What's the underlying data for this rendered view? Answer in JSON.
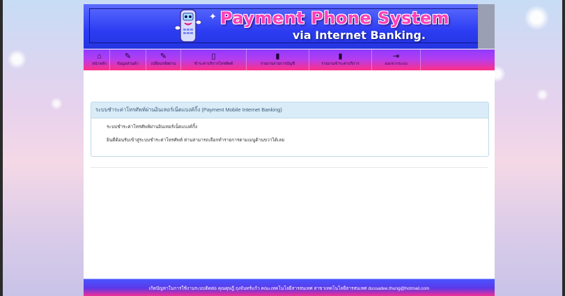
{
  "banner": {
    "title": "Payment Phone System",
    "subtitle": "via Internet Banking."
  },
  "nav": {
    "items": [
      {
        "label": "หน้าหลัก",
        "icon": "home-icon",
        "glyph": "⌂"
      },
      {
        "label": "ข้อมูลส่วนตัว",
        "icon": "edit-icon",
        "glyph": "✎"
      },
      {
        "label": "เปลี่ยนรหัสผ่าน",
        "icon": "edit-icon",
        "glyph": "✎"
      },
      {
        "label": "ชำระค่าบริการโทรศัพท์",
        "icon": "mobile-icon",
        "glyph": "▯"
      },
      {
        "label": "รายงานรายการบัญชี",
        "icon": "file-icon",
        "glyph": "▮"
      },
      {
        "label": "รายงานชำระค่าบริการ",
        "icon": "file-icon",
        "glyph": "▮"
      },
      {
        "label": "ออกจากระบบ",
        "icon": "logout-icon",
        "glyph": "⇥"
      }
    ]
  },
  "panel": {
    "heading": "ระบบชำระค่าโทรศัพท์ผ่านอินเทอร์เน็ตแบงค์กิ้ง (Payment Mobile Internet Banking)",
    "line1": "ระบบชำระค่าโทรศัพท์ผ่านอินเทอร์เน็ตแบงค์กิ้ง",
    "line2": "ยินดีต้อนรับเข้าสู่ระบบชำระค่าโทรศัพท์ ท่านสามารถเลือกทำรายการตามเมนูด้านขวาได้เลย"
  },
  "footer": {
    "text": "เกิดปัญหาในการใช้งานระบบติดต่อ คุณดุษฎี ถุงจันทร์แก้ว คณะเทคโนโลยีสารสนเทศ สาขาเทคโนโลยีสารสนเทศ dussadee.thung@hotmail.com"
  },
  "colors": {
    "banner": "#2c3df2",
    "title": "#ff3fb8",
    "nav_gradient_top": "#8f3cff",
    "nav_gradient_bottom": "#ff2f86",
    "panel_head": "#d9ecf7"
  }
}
